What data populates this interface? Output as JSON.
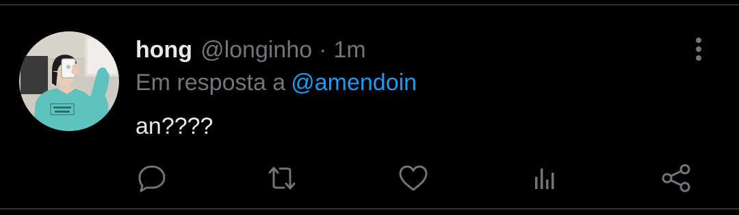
{
  "tweet": {
    "author": {
      "display_name": "hong",
      "handle": "@longinho",
      "separator": "·",
      "time": "1m"
    },
    "reply": {
      "prefix": "Em resposta a",
      "to_handle": "@amendoin"
    },
    "text": "an????"
  },
  "actions": [
    "reply",
    "retweet",
    "like",
    "view-analytics",
    "share"
  ],
  "colors": {
    "background": "#000000",
    "primary_text": "#e7e9ea",
    "secondary_text": "#71767b",
    "accent": "#1d9bf0",
    "divider": "#2f3336"
  }
}
